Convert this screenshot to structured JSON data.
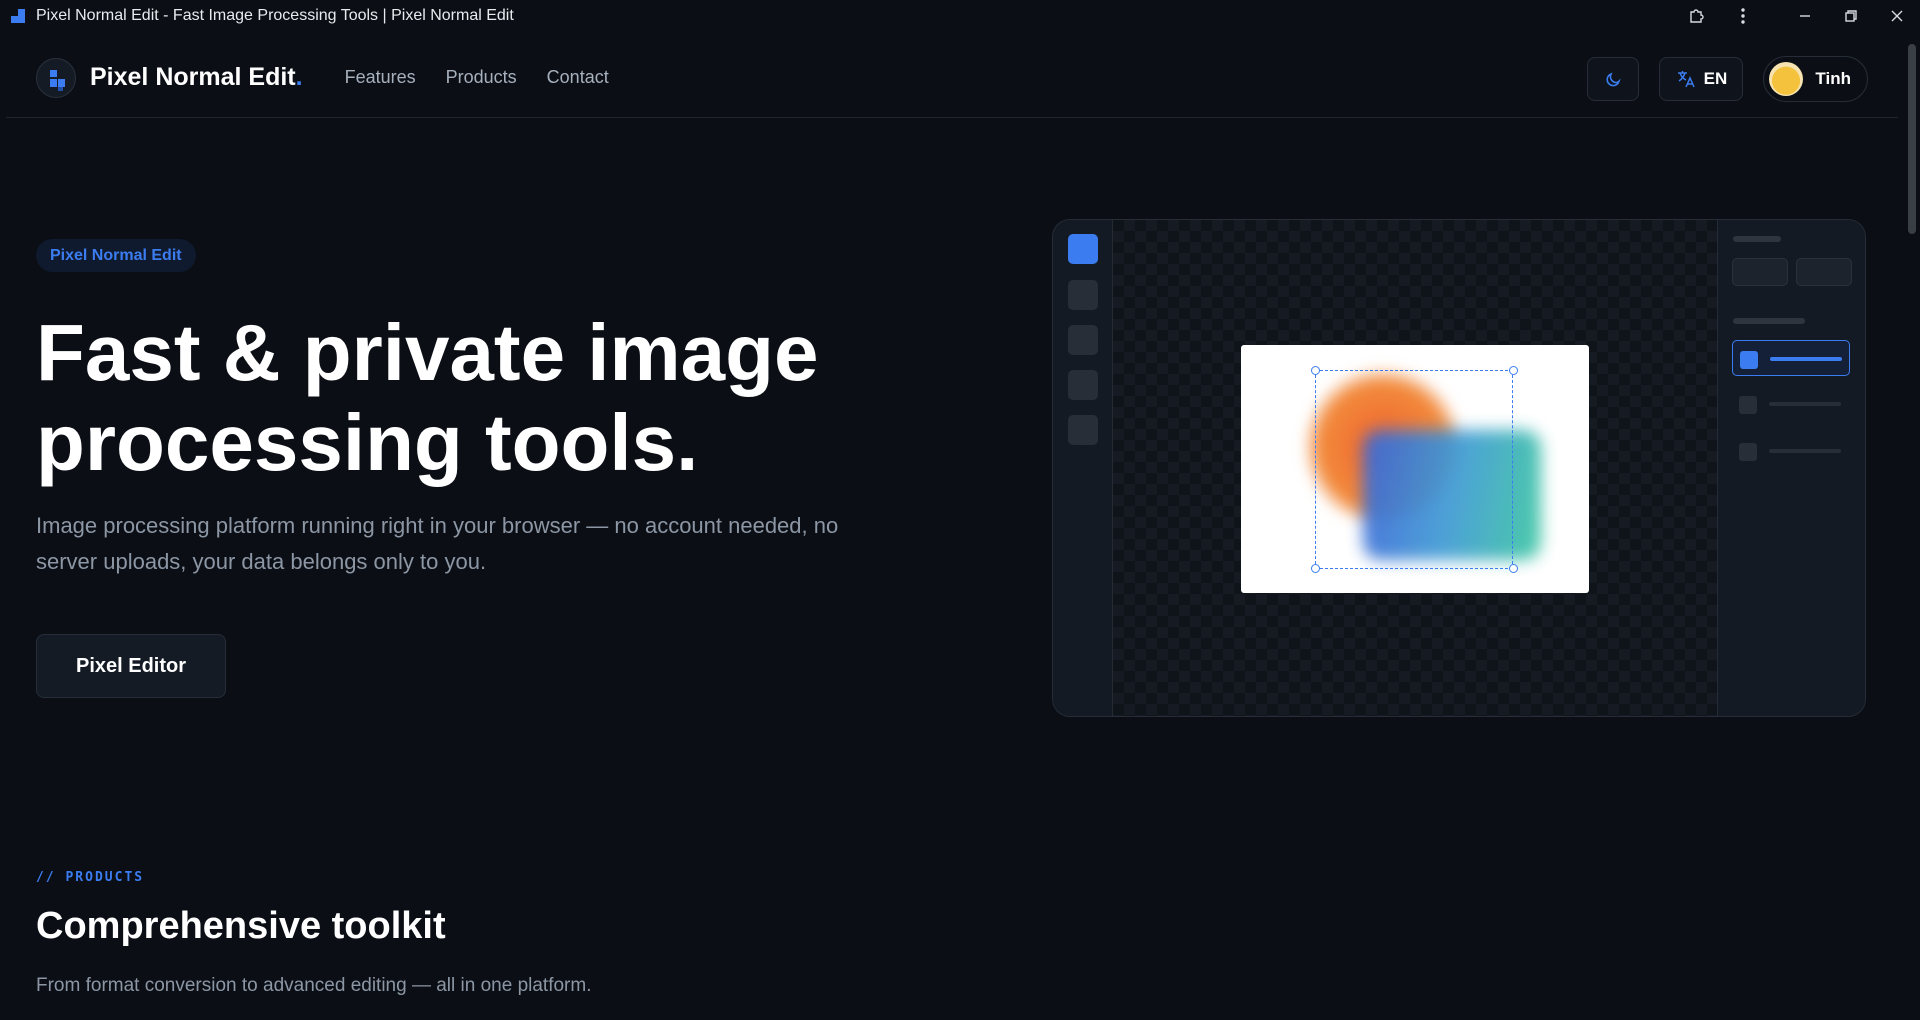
{
  "window": {
    "title": "Pixel Normal Edit - Fast Image Processing Tools | Pixel Normal Edit"
  },
  "nav": {
    "brand": "Pixel Normal Edit",
    "brand_dot": ".",
    "links": [
      "Features",
      "Products",
      "Contact"
    ],
    "language": "EN",
    "user_name": "Tinh"
  },
  "hero": {
    "badge": "Pixel Normal Edit",
    "title_line1": "Fast & private image",
    "title_line2": "processing tools.",
    "subtitle": "Image processing platform running right in your browser — no account needed, no server uploads, your data belongs only to you.",
    "cta": "Pixel Editor"
  },
  "products_section": {
    "kicker": "// PRODUCTS",
    "title": "Comprehensive toolkit",
    "subtitle": "From format conversion to advanced editing — all in one platform."
  },
  "colors": {
    "accent": "#3b7df0",
    "background": "#0b0f15"
  }
}
